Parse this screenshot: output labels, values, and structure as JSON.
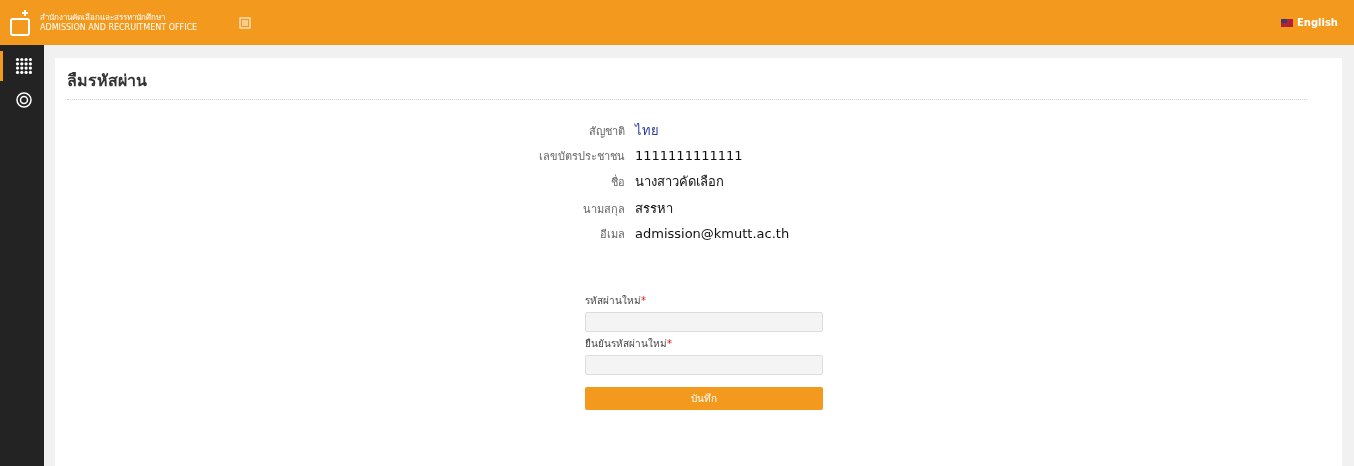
{
  "header": {
    "org_name": "สำนักงานคัดเลือกและสรรหานักศึกษา",
    "org_subtitle": "ADMISSION AND RECRUITMENT OFFICE",
    "language": "English"
  },
  "sidebar": {
    "items": [
      {
        "kind": "grid",
        "selected": true
      },
      {
        "kind": "support",
        "selected": false
      }
    ]
  },
  "page": {
    "title": "ลืมรหัสผ่าน"
  },
  "info": [
    {
      "label": "สัญชาติ",
      "value": "ไทย",
      "kind": "link"
    },
    {
      "label": "เลขบัตรประชาชน",
      "value": "1111111111111",
      "kind": "text"
    },
    {
      "label": "ชื่อ",
      "value": "นางสาวคัดเลือก",
      "kind": "text"
    },
    {
      "label": "นามสกุล",
      "value": "สรรหา",
      "kind": "text"
    },
    {
      "label": "อีเมล",
      "value": "admission@kmutt.ac.th",
      "kind": "text"
    }
  ],
  "form": {
    "fields": [
      {
        "label": "รหัสผ่านใหม่",
        "required_mark": "*"
      },
      {
        "label": "ยืนยันรหัสผ่านใหม่",
        "required_mark": "*"
      }
    ],
    "submit": "บันทึก"
  }
}
